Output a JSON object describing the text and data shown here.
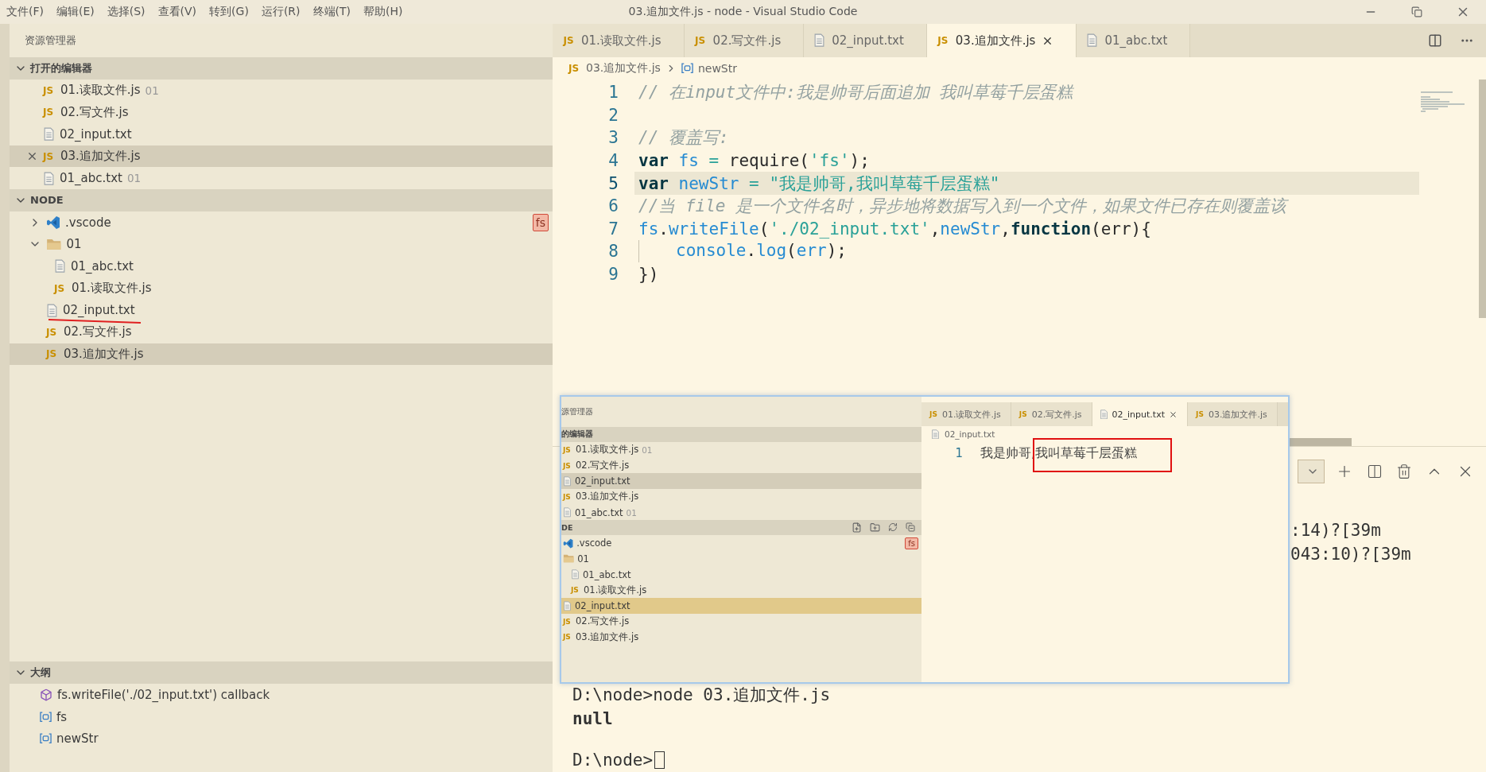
{
  "menu": [
    "文件(F)",
    "编辑(E)",
    "选择(S)",
    "查看(V)",
    "转到(G)",
    "运行(R)",
    "终端(T)",
    "帮助(H)"
  ],
  "window": {
    "title": "03.追加文件.js - node - Visual Studio Code"
  },
  "sidebar": {
    "title": "资源管理器",
    "open_editors": {
      "title": "打开的编辑器",
      "expanded": true,
      "items": [
        {
          "icon": "JS",
          "label": "01.读取文件.js",
          "hint": "01",
          "selected": false
        },
        {
          "icon": "JS",
          "label": "02.写文件.js",
          "selected": false
        },
        {
          "kind": "txt",
          "label": "02_input.txt",
          "selected": false
        },
        {
          "icon": "JS",
          "label": "03.追加文件.js",
          "selected": true
        },
        {
          "kind": "txt",
          "label": "01_abc.txt",
          "hint": "01",
          "selected": false
        }
      ]
    },
    "folder": {
      "title": "NODE",
      "expanded": true,
      "items": [
        {
          "kind": "vscode",
          "label": ".vscode",
          "expanded": false,
          "selected": false,
          "underlined": false,
          "tag": "fs"
        },
        {
          "kind": "folder",
          "label": "01",
          "expanded": true,
          "selected": false,
          "underlined": false,
          "children": [
            {
              "kind": "txt",
              "label": "01_abc.txt",
              "selected": false,
              "underlined": false
            },
            {
              "icon": "JS",
              "label": "01.读取文件.js",
              "selected": false,
              "underlined": false
            }
          ]
        },
        {
          "kind": "txt",
          "label": "02_input.txt",
          "selected": false,
          "underlined": true
        },
        {
          "icon": "JS",
          "label": "02.写文件.js",
          "selected": false,
          "underlined": false
        },
        {
          "icon": "JS",
          "label": "03.追加文件.js",
          "selected": true,
          "underlined": false
        }
      ]
    },
    "outline": {
      "title": "大纲",
      "expanded": true,
      "items": [
        {
          "kind": "callback",
          "label": "fs.writeFile('./02_input.txt') callback"
        },
        {
          "kind": "variable",
          "label": "fs"
        },
        {
          "kind": "variable",
          "label": "newStr"
        }
      ]
    }
  },
  "editor": {
    "tabs": [
      {
        "icon": "JS",
        "label": "01.读取文件.js",
        "selected": false
      },
      {
        "icon": "JS",
        "label": "02.写文件.js",
        "selected": false
      },
      {
        "kind": "txt",
        "label": "02_input.txt",
        "selected": false
      },
      {
        "icon": "JS",
        "label": "03.追加文件.js",
        "selected": true
      },
      {
        "kind": "txt",
        "label": "01_abc.txt",
        "selected": false
      }
    ],
    "breadcrumb": [
      {
        "icon": "JS",
        "label": "03.追加文件.js"
      },
      {
        "kind": "variable",
        "label": "newStr"
      }
    ],
    "lines": [
      {
        "number": "1",
        "current": false,
        "tokens": [
          {
            "kind": "comment",
            "text": "// 在input文件中:我是帅哥后面追加 我叫草莓千层蛋糕"
          }
        ]
      },
      {
        "number": "2",
        "current": false
      },
      {
        "number": "3",
        "current": false,
        "tokens": [
          {
            "kind": "comment",
            "text": "// 覆盖写:"
          }
        ]
      },
      {
        "number": "4",
        "current": false,
        "tokens": [
          {
            "kind": "keyword",
            "text": "var"
          },
          {
            "kind": "variable",
            "text": " fs"
          },
          {
            "kind": "operator",
            "text": " = "
          },
          {
            "kind": "plain",
            "text": "require("
          },
          {
            "kind": "string",
            "text": "'fs'"
          },
          {
            "kind": "plain",
            "text": ");"
          }
        ]
      },
      {
        "number": "5",
        "current": true,
        "tokens": [
          {
            "kind": "keyword",
            "text": "var"
          },
          {
            "kind": "variable",
            "text": " newStr"
          },
          {
            "kind": "operator",
            "text": " = "
          },
          {
            "kind": "string",
            "text": "\"我是帅哥,我叫草莓千层蛋糕\""
          }
        ]
      },
      {
        "number": "6",
        "current": false,
        "tokens": [
          {
            "kind": "comment",
            "text": "//当 file 是一个文件名时，异步地将数据写入到一个文件，如果文件已存在则覆盖该"
          }
        ]
      },
      {
        "number": "7",
        "current": false,
        "tokens": [
          {
            "kind": "variable",
            "text": "fs"
          },
          {
            "kind": "plain",
            "text": "."
          },
          {
            "kind": "variable",
            "text": "writeFile"
          },
          {
            "kind": "plain",
            "text": "("
          },
          {
            "kind": "string",
            "text": "'./02_input.txt'"
          },
          {
            "kind": "plain",
            "text": ","
          },
          {
            "kind": "variable",
            "text": "newStr"
          },
          {
            "kind": "plain",
            "text": ","
          },
          {
            "kind": "keyword",
            "text": "function"
          },
          {
            "kind": "plain",
            "text": "(err){"
          }
        ]
      },
      {
        "number": "8",
        "current": false,
        "tokens": [
          {
            "kind": "indent"
          },
          {
            "kind": "variable",
            "text": "console"
          },
          {
            "kind": "plain",
            "text": "."
          },
          {
            "kind": "variable",
            "text": "log"
          },
          {
            "kind": "plain",
            "text": "("
          },
          {
            "kind": "variable",
            "text": "err"
          },
          {
            "kind": "plain",
            "text": ");"
          }
        ]
      },
      {
        "number": "9",
        "current": false,
        "tokens": [
          {
            "kind": "plain",
            "text": "})"
          }
        ]
      }
    ]
  },
  "terminal": {
    "tail_lines": [
      ":14)?[39m",
      "043:10)?[39m"
    ],
    "lines": [
      {
        "kind": "command",
        "text": "D:\\node>node 03.追加文件.js"
      },
      {
        "kind": "output",
        "text": "null"
      },
      {
        "kind": "prompt",
        "text": "D:\\node>"
      }
    ]
  },
  "inset": {
    "sidebar": {
      "title": "源管理器",
      "open_editors": {
        "title": "的编辑器",
        "items": [
          {
            "icon": "JS",
            "label": "01.读取文件.js",
            "hint": "01",
            "selected": false
          },
          {
            "icon": "JS",
            "label": "02.写文件.js",
            "selected": false
          },
          {
            "kind": "txt",
            "label": "02_input.txt",
            "selected": true
          },
          {
            "icon": "JS",
            "label": "03.追加文件.js",
            "selected": false
          },
          {
            "kind": "txt",
            "label": "01_abc.txt",
            "hint": "01",
            "selected": false
          }
        ]
      },
      "folder": {
        "title": "DE",
        "items": [
          {
            "kind": "vscode",
            "label": ".vscode",
            "selected": false,
            "tag": "fs"
          },
          {
            "kind": "folder",
            "label": "01",
            "selected": false,
            "children": [
              {
                "kind": "txt",
                "label": "01_abc.txt",
                "selected": false
              },
              {
                "icon": "JS",
                "label": "01.读取文件.js",
                "selected": false
              }
            ]
          },
          {
            "kind": "txt",
            "label": "02_input.txt",
            "selected": true
          },
          {
            "icon": "JS",
            "label": "02.写文件.js",
            "selected": false
          },
          {
            "icon": "JS",
            "label": "03.追加文件.js",
            "selected": false
          }
        ]
      }
    },
    "tabs": [
      {
        "icon": "JS",
        "label": "01.读取文件.js",
        "selected": false
      },
      {
        "icon": "JS",
        "label": "02.写文件.js",
        "selected": false
      },
      {
        "kind": "txt",
        "label": "02_input.txt",
        "selected": true
      },
      {
        "icon": "JS",
        "label": "03.追加文件.js",
        "selected": false
      }
    ],
    "breadcrumb": {
      "kind": "txt",
      "label": "02_input.txt"
    },
    "lines": [
      {
        "number": "1",
        "text": "我是帅哥,我叫草莓千层蛋糕"
      }
    ]
  }
}
